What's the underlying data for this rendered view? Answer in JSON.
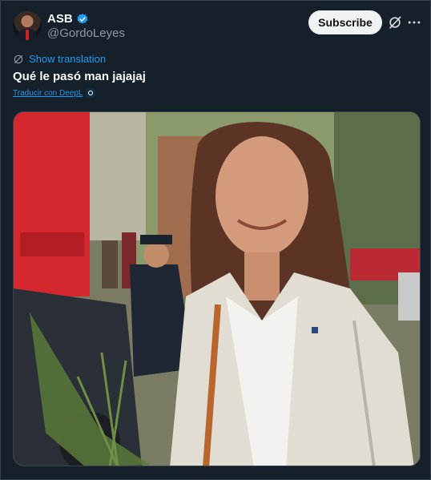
{
  "author": {
    "name": "ASB",
    "handle": "@GordoLeyes"
  },
  "subscribe_label": "Subscribe",
  "show_translation_label": "Show translation",
  "tweet_text": "Qué le pasó man jajajaj",
  "deepl_label": "Traducir con DeepL",
  "colors": {
    "background": "#15202b",
    "accent": "#1d9bf0",
    "verified": "#1d9bf0",
    "muted": "#8b98a5"
  },
  "icons": [
    "verified-badge-icon",
    "grok-icon",
    "more-icon",
    "translate-icon",
    "deepl-icon"
  ]
}
